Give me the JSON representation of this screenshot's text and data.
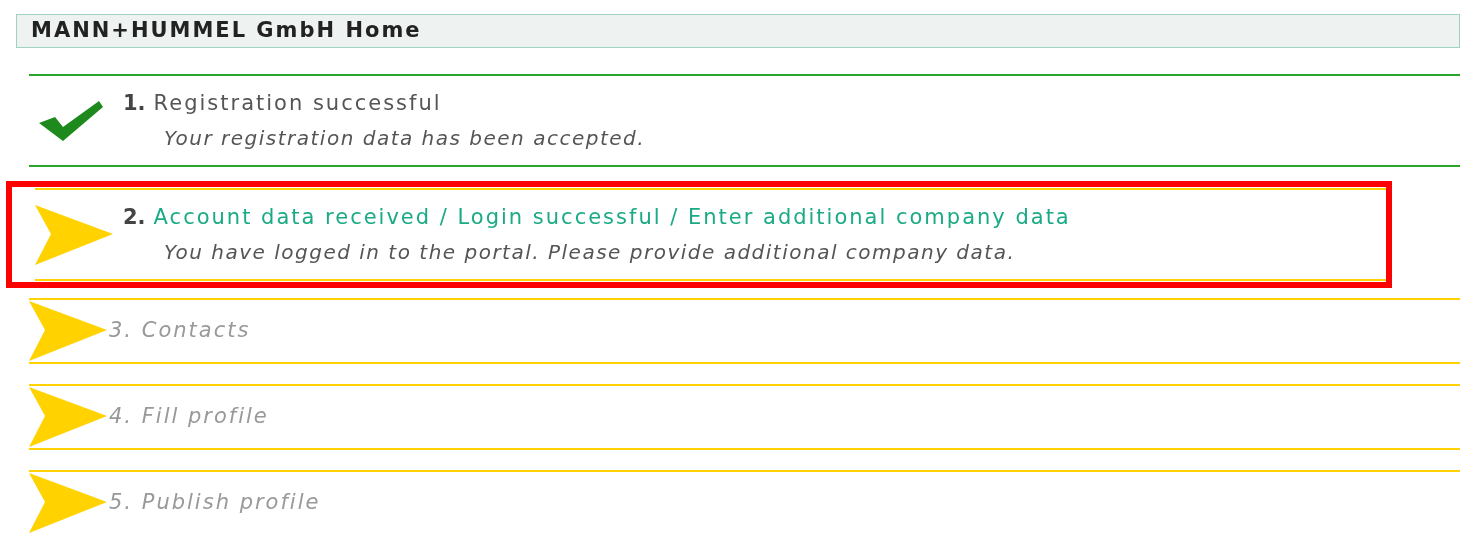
{
  "header": {
    "title": "MANN+HUMMEL GmbH Home"
  },
  "steps": [
    {
      "number": "1.",
      "title": "Registration successful",
      "description": "Your registration data has been accepted.",
      "kind": "done",
      "highlighted": false
    },
    {
      "number": "2.",
      "title": "Account data received / Login successful / Enter additional company data",
      "description": "You have logged in to the portal. Please provide additional company data.",
      "kind": "current",
      "highlighted": true
    },
    {
      "number": "3.",
      "title": "Contacts",
      "kind": "pending",
      "highlighted": false
    },
    {
      "number": "4.",
      "title": "Fill profile",
      "kind": "pending",
      "highlighted": false
    },
    {
      "number": "5.",
      "title": "Publish profile",
      "kind": "pending",
      "highlighted": false
    }
  ]
}
